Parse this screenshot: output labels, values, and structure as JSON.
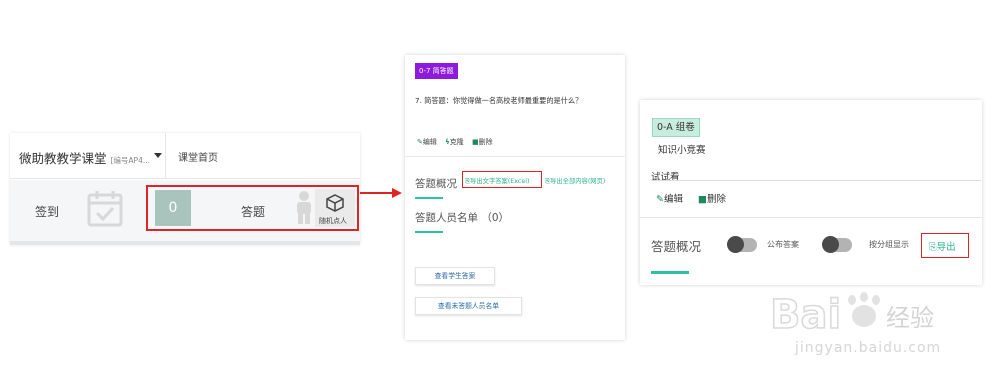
{
  "panel1": {
    "course_title": "微助教教学课堂",
    "course_id": "[编号AP4...",
    "nav_home": "课堂首页",
    "signin_label": "签到",
    "answer_count": "0",
    "answer_label": "答题",
    "random_pick_label": "随机点人"
  },
  "panel2": {
    "tag": "0-7 简答题",
    "question": "7. 简答题：你觉得做一名高校老师最重要的是什么？",
    "actions": {
      "edit": "编辑",
      "clone": "克隆",
      "delete": "删除"
    },
    "overview_title": "答题概况",
    "export_text": "导出文字答案(Excel)",
    "export_all": "导出全部内容(网页)",
    "list_title": "答题人员名单 （0）",
    "btn_view_answers": "查看学生答案",
    "btn_view_unanswered": "查看未答题人员名单"
  },
  "panel3": {
    "tag": "0-A 组卷",
    "subtitle": "知识小竞赛",
    "item": "试试看",
    "actions": {
      "edit": "编辑",
      "delete": "删除"
    },
    "overview_title": "答题概况",
    "toggle1_label": "公布答案",
    "toggle2_label": "按分组显示",
    "export": "导出"
  },
  "watermark": {
    "brand": "Bai 经验",
    "url": "jingyan.baidu.com"
  },
  "colors": {
    "accent_green": "#2bc4a3",
    "highlight_red": "#e02424",
    "tag_purple": "#8e1adb",
    "tag_mint": "#c9ecdf"
  }
}
